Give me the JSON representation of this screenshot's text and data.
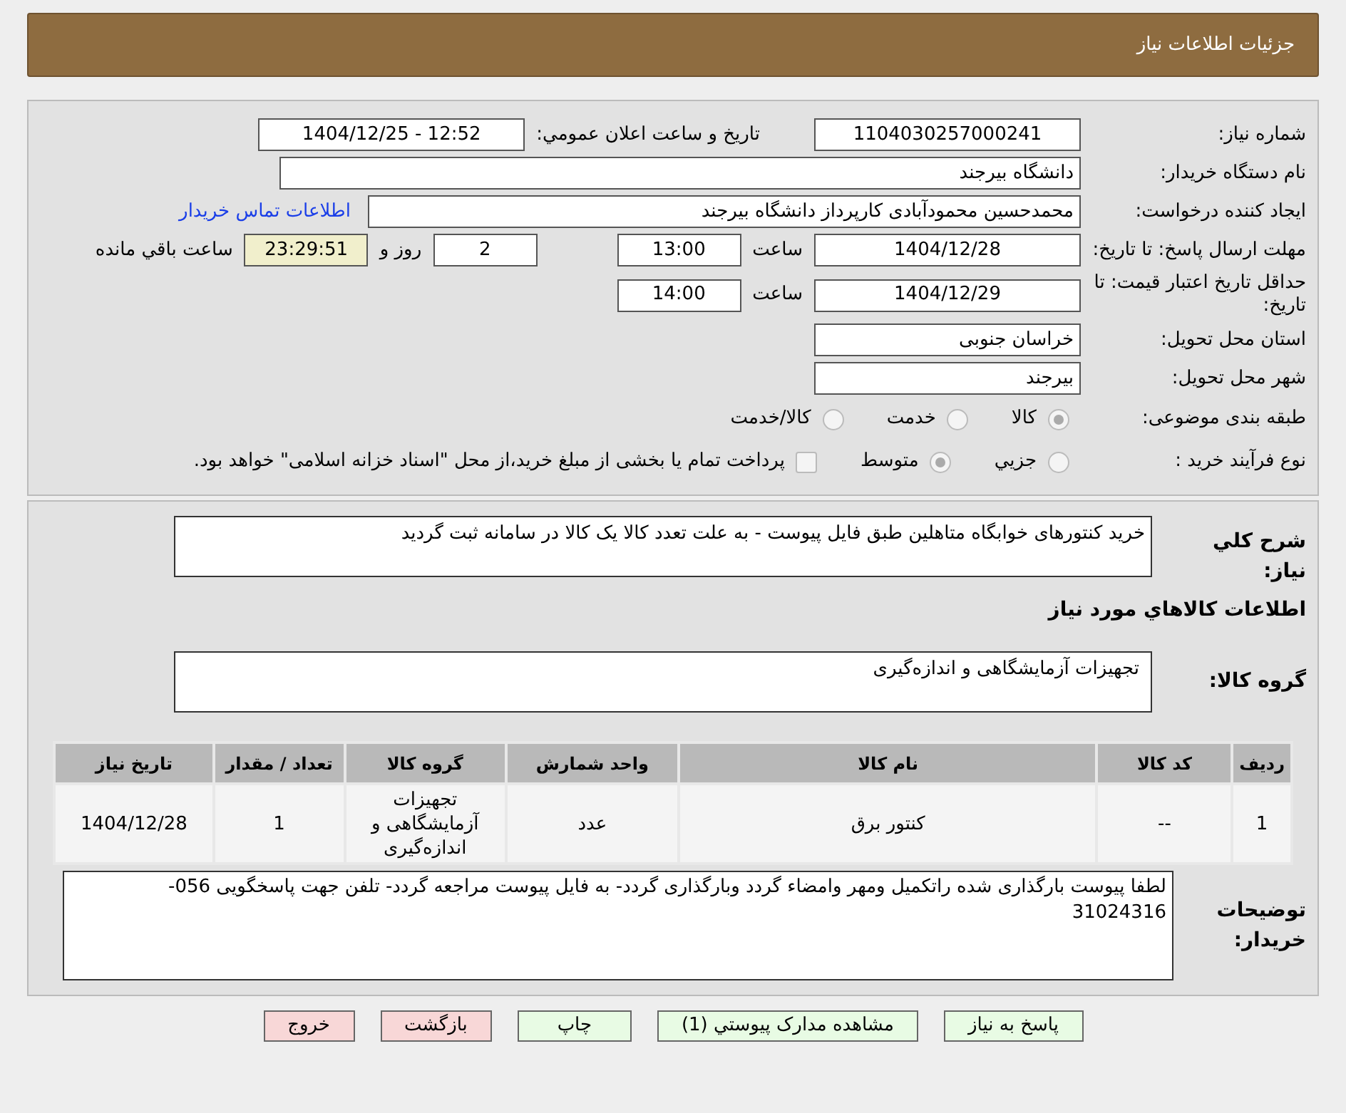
{
  "header": {
    "title": "جزئیات اطلاعات نیاز"
  },
  "need_number": {
    "label": "شماره نیاز:",
    "value": "1104030257000241"
  },
  "announce": {
    "label": "تاریخ و ساعت اعلان عمومي:",
    "value": "1404/12/25 - 12:52"
  },
  "buyer_org": {
    "label": "نام دستگاه خریدار:",
    "value": "دانشگاه بیرجند"
  },
  "creator": {
    "label": "ایجاد کننده درخواست:",
    "value": "محمدحسین محمودآبادی کارپرداز دانشگاه بیرجند",
    "link": "اطلاعات تماس خریدار"
  },
  "deadline": {
    "label": "مهلت ارسال پاسخ: تا تاریخ:",
    "date": "1404/12/28",
    "time_label": "ساعت",
    "time": "13:00",
    "days": "2",
    "days_label": "روز و",
    "remaining": "23:29:51",
    "remaining_label": "ساعت باقي مانده"
  },
  "validity": {
    "label": "حداقل تاریخ اعتبار قیمت: تا تاریخ:",
    "date": "1404/12/29",
    "time_label": "ساعت",
    "time": "14:00"
  },
  "province": {
    "label": "استان محل تحویل:",
    "value": "خراسان جنوبی"
  },
  "city": {
    "label": "شهر محل تحویل:",
    "value": "بیرجند"
  },
  "category": {
    "label": "طبقه بندی موضوعی:",
    "options": [
      {
        "label": "کالا",
        "selected": true
      },
      {
        "label": "خدمت",
        "selected": false
      },
      {
        "label": "کالا/خدمت",
        "selected": false
      }
    ]
  },
  "process": {
    "label": "نوع فرآیند خرید :",
    "options": [
      {
        "label": "جزيي",
        "selected": false
      },
      {
        "label": "متوسط",
        "selected": true
      }
    ],
    "treasury": {
      "checked": false,
      "label": "پرداخت تمام یا بخشی از مبلغ خرید،از محل \"اسناد خزانه اسلامی\" خواهد بود."
    }
  },
  "summary": {
    "label": "شرح کلي نیاز:",
    "value": "خرید کنتورهای خوابگاه متاهلین طبق فایل پیوست - به علت تعدد کالا یک کالا در سامانه ثبت گردید"
  },
  "goods_heading": "اطلاعات کالاهاي مورد نياز",
  "goods_group": {
    "label": "گروه کالا:",
    "value": "تجهیزات آزمایشگاهی و اندازه‌گیری"
  },
  "table": {
    "columns": [
      "ردیف",
      "کد کالا",
      "نام کالا",
      "واحد شمارش",
      "گروه کالا",
      "تعداد / مقدار",
      "تاریخ نیاز"
    ],
    "rows": [
      [
        "1",
        "--",
        "کنتور برق",
        "عدد",
        "تجهیزات آزمایشگاهی و اندازه‌گیری",
        "1",
        "1404/12/28"
      ]
    ]
  },
  "notes": {
    "label": "توضیحات خریدار:",
    "value": "لطفا پیوست بارگذاری شده راتکمیل ومهر وامضاء گردد وبارگذاری گردد- به فایل پیوست مراجعه گردد- تلفن جهت پاسخگویی 056- 31024316"
  },
  "buttons": [
    {
      "label": "پاسخ به نیاز",
      "kind": "action"
    },
    {
      "label": "مشاهده مدارک پیوستي (1)",
      "kind": "action"
    },
    {
      "label": "چاپ",
      "kind": "action"
    },
    {
      "label": "بازگشت",
      "kind": "danger"
    },
    {
      "label": "خروج",
      "kind": "danger"
    }
  ]
}
